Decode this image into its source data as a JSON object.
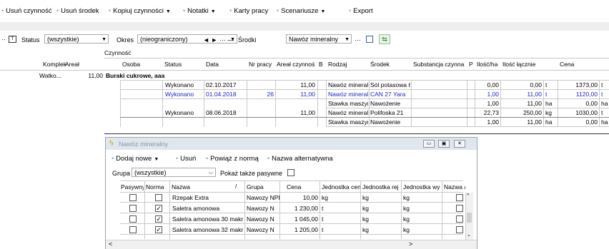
{
  "toolbar": {
    "items": [
      {
        "label": "Usuń czynność"
      },
      {
        "label": "Usuń środek"
      },
      {
        "label": "Kopiuj czynności"
      },
      {
        "label": "Notatki"
      },
      {
        "label": "Karty pracy"
      },
      {
        "label": "Scenariusze"
      },
      {
        "label": "Export"
      }
    ]
  },
  "filter": {
    "status_label": "Status",
    "status_value": "(wszystkie)",
    "okres_label": "Okres",
    "okres_value": "(nieograniczony)",
    "srodki_label": "Środki",
    "srodki_value": "Nawóz mineralny",
    "nav_text": "◄ ► ··· —"
  },
  "grid": {
    "group_header": "Czynność",
    "columns": [
      "Kompleks",
      "Areał",
      "Osoba",
      "Status",
      "Data",
      "Nr pracy",
      "Areał czynnoś",
      "B",
      "Rodzaj",
      "Środek",
      "Substancja czynna",
      "P",
      "Ilość/ha",
      "Ilość łącznie",
      "Cena"
    ],
    "parent": {
      "kompleks": "Watko...",
      "areal": "11,00"
    },
    "group_title": "Buraki cukrowe, aaa",
    "rows": [
      {
        "status": "Wykonano",
        "data": "02.10.2017",
        "nr": "",
        "areal": "11,00",
        "rodzaj": "Nawóz mineralr",
        "srodek": "Sól potasowa 6",
        "ilosc_ha": "0,00",
        "ilosc_lacznie": "0,00",
        "jm": "t",
        "cena": "1373,00",
        "cena_jm": "t",
        "blue": false
      },
      {
        "status": "Wykonano",
        "data": "01.04.2018",
        "nr": "26",
        "areal": "11,00",
        "rodzaj": "Nawóz mineralr",
        "srodek": "CAN 27 Yara",
        "ilosc_ha": "1,00",
        "ilosc_lacznie": "11,00",
        "jm": "t",
        "cena": "1120,00",
        "cena_jm": "t",
        "blue": true
      },
      {
        "status": "",
        "data": "",
        "nr": "",
        "areal": "",
        "rodzaj": "Stawka maszyr",
        "srodek": "Nawożenie",
        "ilosc_ha": "1,00",
        "ilosc_lacznie": "11,00",
        "jm": "ha",
        "cena": "0,00",
        "cena_jm": "ha",
        "blue": false
      },
      {
        "status": "Wykonano",
        "data": "08.06.2018",
        "nr": "",
        "areal": "11,00",
        "rodzaj": "Nawóz mineralr",
        "srodek": "Polifoska 21",
        "ilosc_ha": "22,73",
        "ilosc_lacznie": "250,00",
        "jm": "kg",
        "cena": "1030,00",
        "cena_jm": "t",
        "blue": false
      },
      {
        "status": "",
        "data": "",
        "nr": "",
        "areal": "",
        "rodzaj": "Stawka maszyr",
        "srodek": "Nawożenie",
        "ilosc_ha": "1,00",
        "ilosc_lacznie": "11,00",
        "jm": "ha",
        "cena": "0,00",
        "cena_jm": "ha",
        "blue": false
      }
    ]
  },
  "dialog": {
    "title": "Nawóz mineralny",
    "toolbar": [
      "Dodaj nowe",
      "Usuń",
      "Powiąż z normą",
      "Nazwa alternatywna"
    ],
    "grupa_label": "Grupa",
    "grupa_value": "(wszystkie)",
    "pokaz_label": "Pokaż także pasywne",
    "columns": [
      "Pasywny",
      "Norma",
      "Nazwa",
      "Grupa",
      "Cena",
      "Jednostka cen",
      "Jednostka rej",
      "Jednostka wy",
      "Nazwa alte"
    ],
    "rows": [
      {
        "pasywny": false,
        "norma": false,
        "nazwa": "Rzepak Extra",
        "grupa": "Nawozy NPK",
        "cena": "10,00",
        "jc": "kg",
        "jr": "kg",
        "jw": "kg"
      },
      {
        "pasywny": false,
        "norma": true,
        "nazwa": "Saletra amonowa",
        "grupa": "Nawozy N",
        "cena": "1 230,00",
        "jc": "t",
        "jr": "kg",
        "jw": "kg"
      },
      {
        "pasywny": false,
        "norma": true,
        "nazwa": "Saletra amonowa 30 makr",
        "grupa": "Nawozy N",
        "cena": "1 045,00",
        "jc": "t",
        "jr": "kg",
        "jw": "kg"
      },
      {
        "pasywny": false,
        "norma": true,
        "nazwa": "Saletra amonowa 32 makr",
        "grupa": "Nawozy N",
        "cena": "1 205,00",
        "jc": "t",
        "jr": "kg",
        "jw": "kg"
      }
    ]
  }
}
